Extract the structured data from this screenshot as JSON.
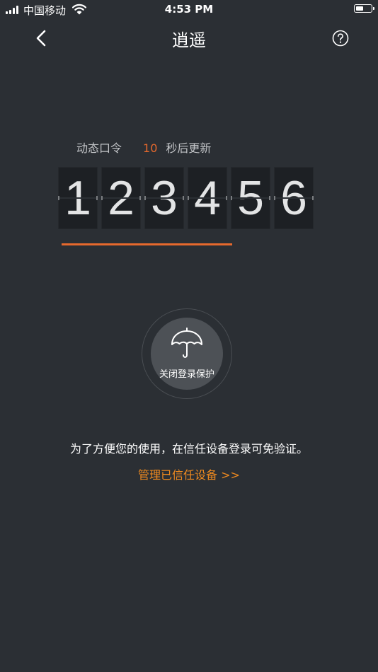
{
  "status_bar": {
    "carrier": "中国移动",
    "time": "4:53 PM",
    "battery_level": 0.55,
    "icons": [
      "signal-icon",
      "wifi-icon",
      "battery-icon"
    ]
  },
  "nav": {
    "title": "逍遥",
    "back_icon": "chevron-left-icon",
    "help_icon": "question-circle-icon"
  },
  "dynamic_code": {
    "label": "动态口令",
    "countdown": "10",
    "suffix": "秒后更新",
    "digits": [
      "1",
      "2",
      "3",
      "4",
      "5",
      "6"
    ],
    "progress_fraction": 0.67
  },
  "protection": {
    "icon": "umbrella-icon",
    "label": "关闭登录保护"
  },
  "info_text": "为了方便您的使用，在信任设备登录可免验证。",
  "manage_link": "管理已信任设备 >>",
  "colors": {
    "background": "#2b2f34",
    "accent": "#e6692d",
    "link": "#ef8a1f"
  }
}
